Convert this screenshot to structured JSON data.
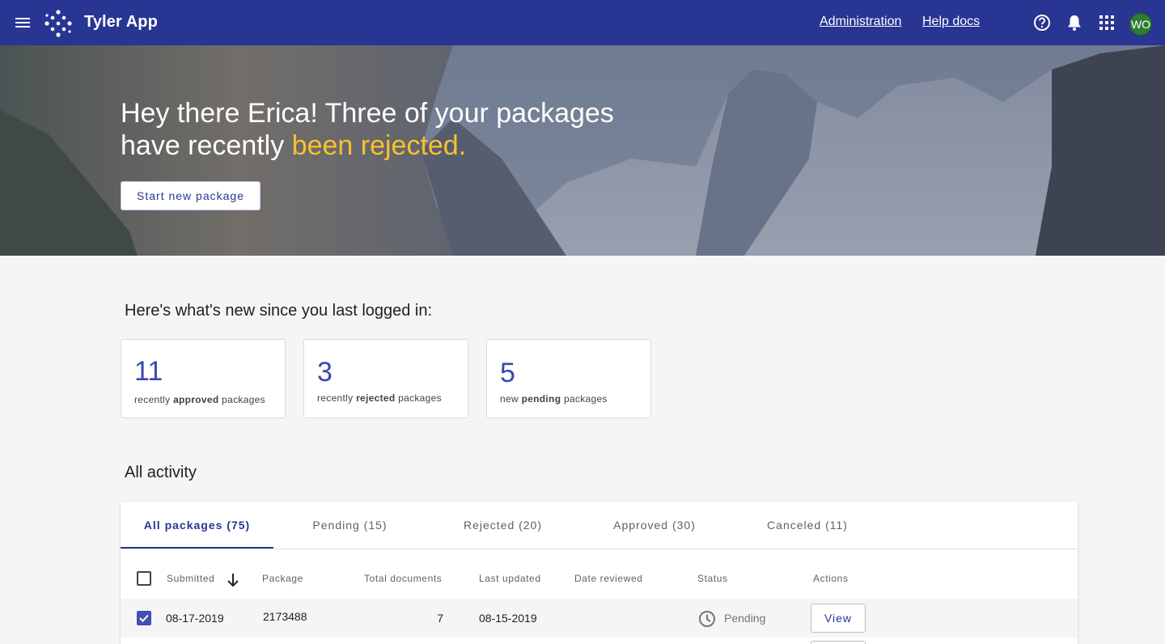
{
  "header": {
    "app_title": "Tyler App",
    "links": [
      "Administration",
      "Help docs"
    ],
    "avatar_initials": "WO",
    "colors": {
      "bar": "#283593",
      "avatar": "#2e7d32"
    },
    "icons": [
      "menu-icon",
      "help-icon",
      "bell-icon",
      "apps-grid-icon"
    ]
  },
  "hero": {
    "headline_part1": "Hey there Erica! Three of your packages have recently ",
    "headline_highlight": "been rejected.",
    "highlight_color": "#fbc02d",
    "cta_label": "Start new package"
  },
  "summary": {
    "title": "Here's what's new since you last logged in:",
    "cards": [
      {
        "number": "11",
        "prefix": "recently ",
        "bold": "approved",
        "suffix": " packages"
      },
      {
        "number": "3",
        "prefix": "recently ",
        "bold": "rejected",
        "suffix": " packages"
      },
      {
        "number": "5",
        "prefix": "new ",
        "bold": "pending",
        "suffix": " packages"
      }
    ]
  },
  "activity": {
    "title": "All activity",
    "tabs": [
      "All packages (75)",
      "Pending (15)",
      "Rejected (20)",
      "Approved (30)",
      "Canceled (11)"
    ],
    "active_tab": 0,
    "columns": [
      "Submitted",
      "Package",
      "Total documents",
      "Last updated",
      "Date reviewed",
      "Status",
      "Actions"
    ],
    "rows": [
      {
        "checked": true,
        "submitted": "08-17-2019",
        "package": "2173488",
        "total_documents": "7",
        "last_updated": "08-15-2019",
        "date_reviewed": "",
        "status": "Pending",
        "action": "View"
      }
    ]
  }
}
